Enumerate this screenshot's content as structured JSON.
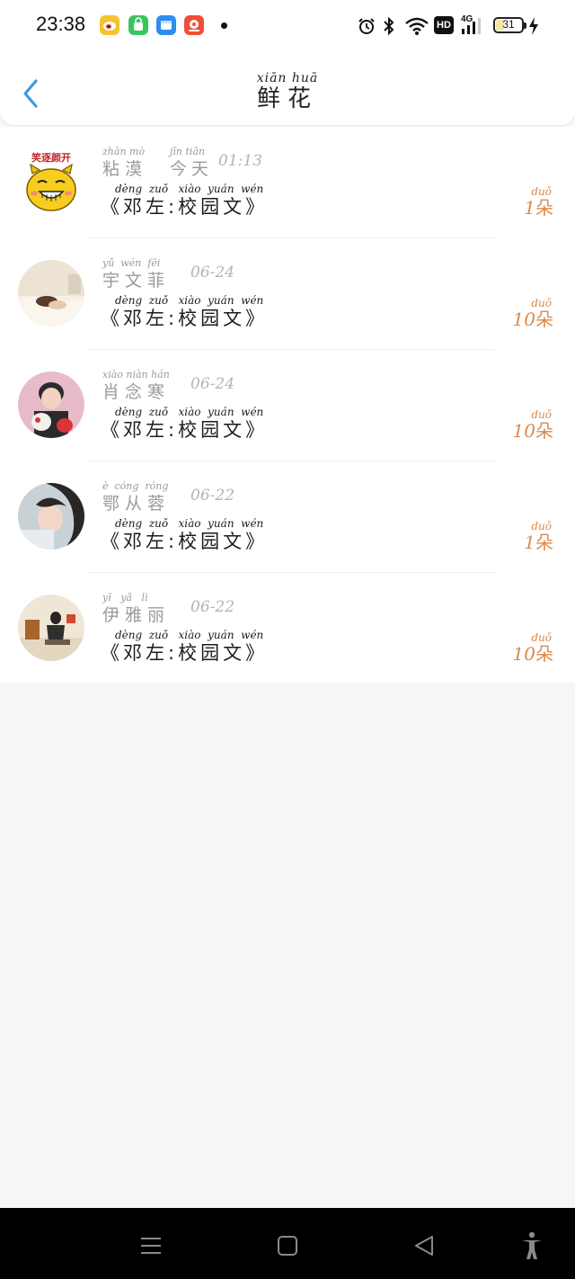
{
  "status_bar": {
    "time": "23:38",
    "app_icons": [
      "weibo-icon",
      "app-store-icon",
      "files-icon",
      "video-app-icon"
    ],
    "system_icons": [
      "alarm-icon",
      "bluetooth-icon",
      "wifi-icon",
      "hd-icon",
      "signal-4g-icon",
      "battery-icon",
      "charging-icon"
    ],
    "network_label": "4G",
    "hd_label": "HD",
    "battery_level": "31",
    "battery_fraction": 0.31
  },
  "header": {
    "title_pinyin": "xiān  huā",
    "title": "鲜花"
  },
  "list": [
    {
      "name_pinyin": "zhān mò",
      "name": "粘漠",
      "date_pinyin": "jīn tiān",
      "date_han": "今天",
      "date": "01:13",
      "work_pinyin": "dèng  zuǒ   xiào  yuán  wén",
      "work": "《邓左:校园文》",
      "count_pinyin": "duǒ",
      "count_num": "1",
      "count_unit": "朵",
      "avatar": "cartoon-cat-avatar",
      "avatar_caption": "笑逐颜开"
    },
    {
      "name_pinyin": "yǔ  wén  fēi",
      "name": "宇文菲",
      "date": "06-24",
      "work_pinyin": "dèng  zuǒ   xiào  yuán  wén",
      "work": "《邓左:校园文》",
      "count_pinyin": "duǒ",
      "count_num": "10",
      "count_unit": "朵",
      "avatar": "photo-avatar-bed"
    },
    {
      "name_pinyin": "xiào niàn hán",
      "name": "肖念寒",
      "date": "06-24",
      "work_pinyin": "dèng  zuǒ   xiào  yuán  wén",
      "work": "《邓左:校园文》",
      "count_pinyin": "duǒ",
      "count_num": "10",
      "count_unit": "朵",
      "avatar": "photo-avatar-boy"
    },
    {
      "name_pinyin": "è  cóng  róng",
      "name": "鄂从蓉",
      "date": "06-22",
      "work_pinyin": "dèng  zuǒ   xiào  yuán  wén",
      "work": "《邓左:校园文》",
      "count_pinyin": "duǒ",
      "count_num": "1",
      "count_unit": "朵",
      "avatar": "photo-avatar-girl"
    },
    {
      "name_pinyin": "yī   yǎ   lì",
      "name": "伊雅丽",
      "date": "06-22",
      "work_pinyin": "dèng  zuǒ   xiào  yuán  wén",
      "work": "《邓左:校园文》",
      "count_pinyin": "duǒ",
      "count_num": "10",
      "count_unit": "朵",
      "avatar": "photo-avatar-room"
    }
  ],
  "nav_bar": {
    "items": [
      "menu-icon",
      "home-icon",
      "back-triangle-icon",
      "accessibility-icon"
    ]
  },
  "colors": {
    "accent_blue": "#3a9be0",
    "flower_count": "#d98a4d",
    "muted_text": "#9b9b9b",
    "background": "#f7f5f6"
  }
}
